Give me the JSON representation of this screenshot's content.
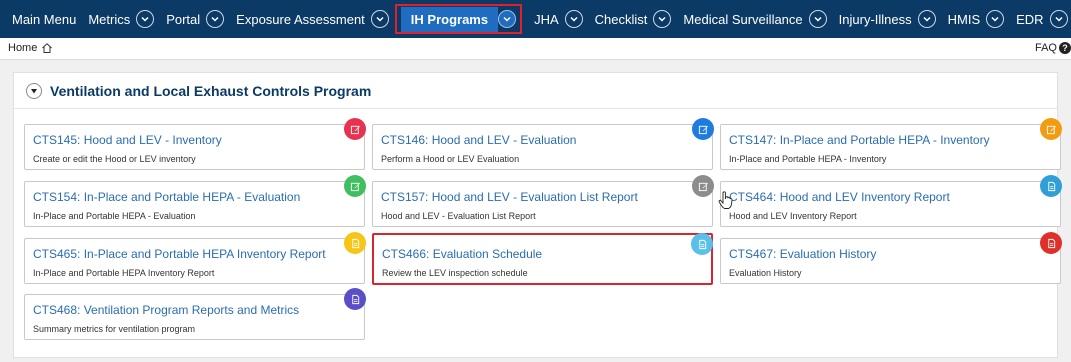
{
  "nav": {
    "items": [
      {
        "label": "Main Menu",
        "chevron": false,
        "active": false
      },
      {
        "label": "Metrics",
        "chevron": true,
        "active": false
      },
      {
        "label": "Portal",
        "chevron": true,
        "active": false
      },
      {
        "label": "Exposure Assessment",
        "chevron": true,
        "active": false
      },
      {
        "label": "IH Programs",
        "chevron": true,
        "active": true
      },
      {
        "label": "JHA",
        "chevron": true,
        "active": false
      },
      {
        "label": "Checklist",
        "chevron": true,
        "active": false
      },
      {
        "label": "Medical Surveillance",
        "chevron": true,
        "active": false
      },
      {
        "label": "Injury-Illness",
        "chevron": true,
        "active": false
      },
      {
        "label": "HMIS",
        "chevron": true,
        "active": false
      },
      {
        "label": "EDR",
        "chevron": true,
        "active": false
      }
    ]
  },
  "breadcrumb": {
    "home_label": "Home"
  },
  "faq_label": "FAQ",
  "region": {
    "title": "Ventilation and Local Exhaust Controls Program"
  },
  "cards": [
    {
      "title": "CTS145: Hood and LEV - Inventory",
      "desc": "Create or edit the Hood or LEV inventory",
      "icon": "edit-icon",
      "color": "#e8334f",
      "highlight": false
    },
    {
      "title": "CTS146: Hood and LEV - Evaluation",
      "desc": "Perform a Hood or LEV Evaluation",
      "icon": "edit-icon",
      "color": "#1e7be0",
      "highlight": false
    },
    {
      "title": "CTS147: In-Place and Portable HEPA - Inventory",
      "desc": "In-Place and Portable HEPA - Inventory",
      "icon": "edit-icon",
      "color": "#f39c12",
      "highlight": false
    },
    {
      "title": "CTS154: In-Place and Portable HEPA - Evaluation",
      "desc": "In-Place and Portable HEPA - Evaluation",
      "icon": "edit-icon",
      "color": "#3fbf5f",
      "highlight": false
    },
    {
      "title": "CTS157: Hood and LEV - Evaluation List Report",
      "desc": "Hood and LEV - Evaluation List Report",
      "icon": "edit-icon",
      "color": "#8c8c8c",
      "highlight": false
    },
    {
      "title": "CTS464: Hood and LEV Inventory Report",
      "desc": "Hood and LEV Inventory Report",
      "icon": "document-icon",
      "color": "#2f9fd6",
      "highlight": false
    },
    {
      "title": "CTS465: In-Place and Portable HEPA Inventory Report",
      "desc": "In-Place and Portable HEPA Inventory Report",
      "icon": "document-icon",
      "color": "#f5c518",
      "highlight": false
    },
    {
      "title": "CTS466: Evaluation Schedule",
      "desc": "Review the LEV inspection schedule",
      "icon": "document-icon",
      "color": "#5bc0e8",
      "highlight": true
    },
    {
      "title": "CTS467: Evaluation History",
      "desc": "Evaluation History",
      "icon": "document-icon",
      "color": "#e0302a",
      "highlight": false
    },
    {
      "title": "CTS468: Ventilation Program Reports and Metrics",
      "desc": "Summary metrics for ventilation program",
      "icon": "document-icon",
      "color": "#5b4fc9",
      "highlight": false
    }
  ]
}
